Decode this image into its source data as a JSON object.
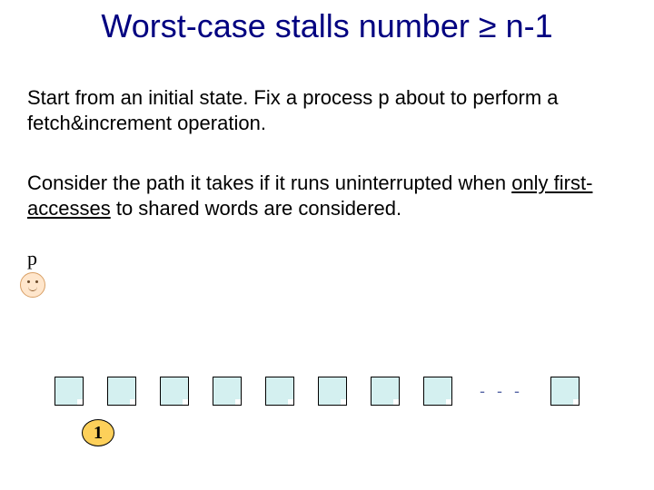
{
  "title": "Worst-case stalls number ≥  n-1",
  "para1_a": "Start from an initial state. Fix a process ",
  "para1_p": "p",
  "para1_b": "  about to perform  a fetch&increment operation.",
  "para2_a": "Consider the path it takes if it runs uninterrupted when ",
  "para2_u": "only  first-accesses",
  "para2_b": " to shared words are considered.",
  "p_label": "p",
  "ellipsis": "- - -",
  "counter_value": "1"
}
